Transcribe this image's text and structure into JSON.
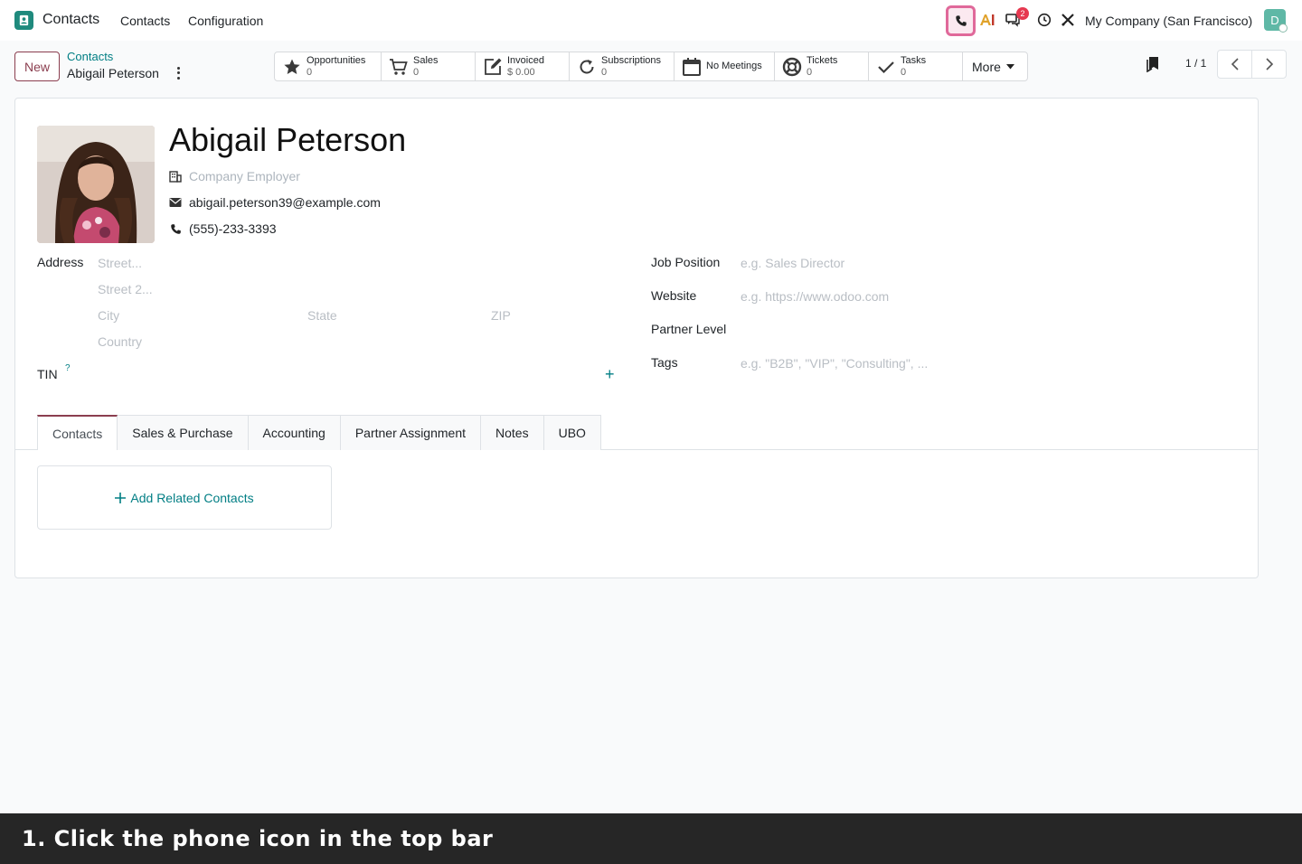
{
  "topbar": {
    "app_name": "Contacts",
    "menu": [
      "Contacts",
      "Configuration"
    ],
    "notification_count": "2",
    "company": "My Company (San Francisco)",
    "avatar_initial": "D",
    "icons": [
      "phone-icon",
      "ai-icon",
      "chat-icon",
      "clock-icon",
      "tools-icon"
    ]
  },
  "control": {
    "new_label": "New",
    "breadcrumb_parent": "Contacts",
    "breadcrumb_current": "Abigail Peterson",
    "pager": "1 / 1"
  },
  "smart_buttons": [
    {
      "label": "Opportunities",
      "value": "0",
      "icon": "star-icon"
    },
    {
      "label": "Sales",
      "value": "0",
      "icon": "cart-icon"
    },
    {
      "label": "Invoiced",
      "value": "$ 0.00",
      "icon": "edit-icon"
    },
    {
      "label": "Subscriptions",
      "value": "0",
      "icon": "refresh-icon"
    },
    {
      "label": "No Meetings",
      "value": "",
      "icon": "calendar-icon"
    },
    {
      "label": "Tickets",
      "value": "0",
      "icon": "lifebuoy-icon"
    },
    {
      "label": "Tasks",
      "value": "0",
      "icon": "check-icon"
    }
  ],
  "more_label": "More",
  "contact": {
    "name": "Abigail Peterson",
    "company_placeholder": "Company Employer",
    "email": "abigail.peterson39@example.com",
    "phone": "(555)-233-3393"
  },
  "address": {
    "label": "Address",
    "street": "Street...",
    "street2": "Street 2...",
    "city": "City",
    "state": "State",
    "zip": "ZIP",
    "country": "Country"
  },
  "tin": {
    "label": "TIN",
    "help": "?"
  },
  "right_fields": {
    "job_label": "Job Position",
    "job_placeholder": "e.g. Sales Director",
    "website_label": "Website",
    "website_placeholder": "e.g. https://www.odoo.com",
    "partner_level_label": "Partner Level",
    "tags_label": "Tags",
    "tags_placeholder": "e.g. \"B2B\", \"VIP\", \"Consulting\", ..."
  },
  "tabs": [
    "Contacts",
    "Sales & Purchase",
    "Accounting",
    "Partner Assignment",
    "Notes",
    "UBO"
  ],
  "add_related": "Add Related Contacts",
  "caption": "1. Click the phone icon in the top bar",
  "colors": {
    "accent": "#8b3e4f",
    "teal": "#017e84",
    "highlight": "#e0699a"
  }
}
